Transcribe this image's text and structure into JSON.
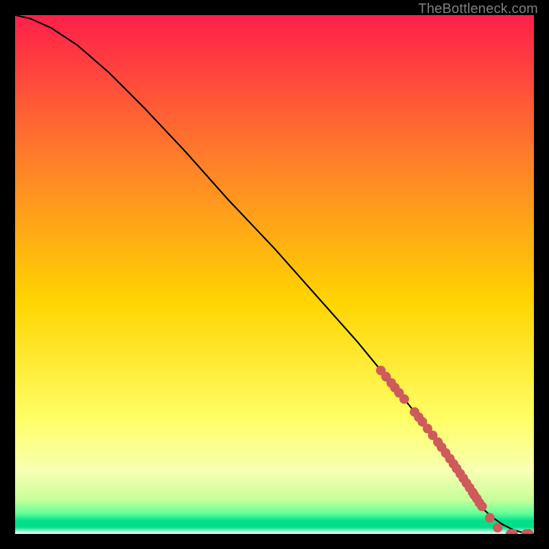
{
  "watermark": "TheBottleneck.com",
  "colors": {
    "bg": "#000000",
    "grad_top": "#ff1f4a",
    "grad_mid_upper": "#ff7f2a",
    "grad_mid": "#ffd400",
    "grad_lower": "#ffff66",
    "grad_pale": "#f7ffb3",
    "grad_green1": "#c6ff99",
    "grad_green2": "#66ff99",
    "grad_green3": "#00e08a",
    "grad_bottom_white": "#ffffff",
    "curve": "#000000",
    "marker": "#cf5a5a"
  },
  "chart_data": {
    "type": "line",
    "title": "",
    "xlabel": "",
    "ylabel": "",
    "xlim": [
      0,
      100
    ],
    "ylim": [
      0,
      100
    ],
    "curve": {
      "x": [
        0,
        3,
        7,
        12,
        18,
        25,
        33,
        41,
        50,
        58,
        66,
        73,
        79,
        83,
        86,
        88,
        90,
        92,
        94,
        96,
        98,
        100
      ],
      "y": [
        100,
        99.3,
        97.5,
        94.2,
        89.0,
        82.0,
        73.5,
        64.5,
        55.0,
        46.0,
        37.0,
        28.5,
        21.0,
        15.2,
        10.8,
        7.6,
        5.0,
        3.2,
        1.8,
        0.8,
        0.2,
        0.0
      ]
    },
    "series": [
      {
        "name": "markers",
        "x": [
          70.5,
          71.5,
          72.5,
          73.2,
          74.0,
          75.0,
          77.0,
          77.8,
          78.5,
          79.5,
          80.5,
          81.5,
          82.2,
          83.0,
          83.8,
          84.5,
          85.1,
          85.8,
          86.4,
          87.0,
          87.6,
          88.2,
          88.5,
          89.0,
          89.5,
          90.0,
          91.5,
          93.0,
          95.5,
          96.0,
          98.5,
          99.0
        ],
        "y": [
          31.5,
          30.3,
          29.1,
          28.2,
          27.2,
          26.0,
          23.5,
          22.5,
          21.6,
          20.3,
          19.0,
          17.7,
          16.7,
          15.6,
          14.5,
          13.5,
          12.6,
          11.6,
          10.7,
          9.8,
          8.9,
          8.0,
          7.5,
          6.8,
          6.0,
          5.3,
          3.1,
          1.2,
          0.0,
          0.0,
          0.0,
          0.0
        ]
      }
    ]
  }
}
